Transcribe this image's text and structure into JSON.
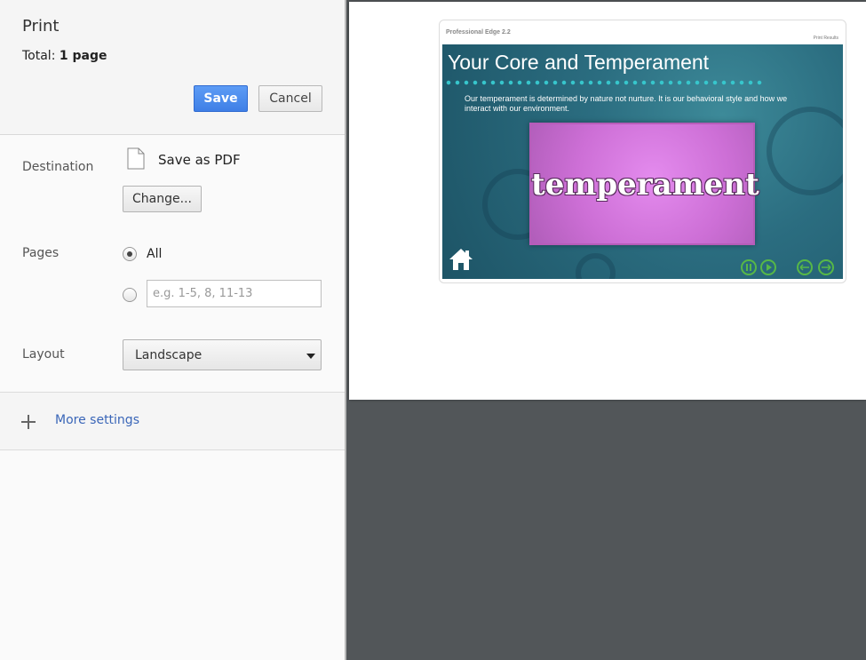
{
  "panel": {
    "title": "Print",
    "total_label": "Total:",
    "total_value": "1 page",
    "save_label": "Save",
    "cancel_label": "Cancel",
    "destination": {
      "label": "Destination",
      "value": "Save as PDF",
      "change_label": "Change..."
    },
    "pages": {
      "label": "Pages",
      "all_label": "All",
      "custom_placeholder": "e.g. 1-5, 8, 11-13",
      "selected": "All"
    },
    "layout": {
      "label": "Layout",
      "value": "Landscape"
    },
    "more_settings_label": "More settings"
  },
  "preview": {
    "brand": "Professional Edge 2.2",
    "print_results": "Print Results",
    "slide_title": "Your Core and Temperament",
    "slide_body": "Our temperament is determined by nature not nurture. It is our behavioral style and how we interact with our environment.",
    "slide_word": "temperament"
  },
  "colors": {
    "accent_blue": "#4a8af4",
    "link_blue": "#3a66b8",
    "preview_bg": "#525659",
    "slide_teal": "#2b6d80",
    "control_green": "#57b847"
  },
  "icons": [
    "pdf-file-icon",
    "plus-icon",
    "home-icon",
    "pause-icon",
    "play-icon",
    "back-arrow-icon",
    "next-arrow-icon"
  ]
}
